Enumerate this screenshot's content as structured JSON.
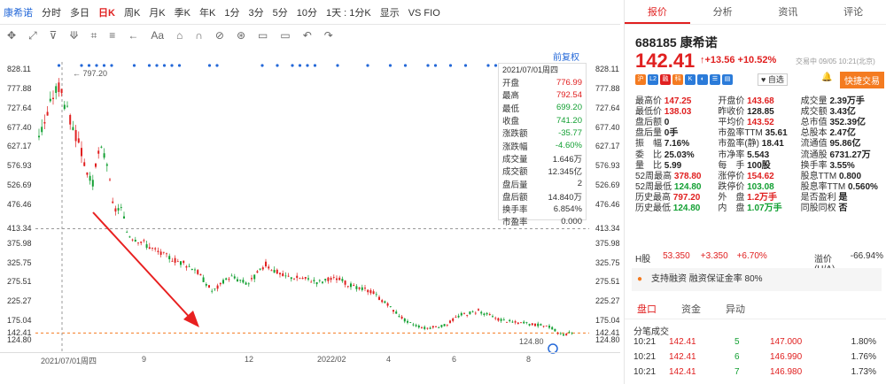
{
  "topbar": {
    "name": "康希诺",
    "items": [
      "分时",
      "多日",
      "日K",
      "周K",
      "月K",
      "季K",
      "年K",
      "1分",
      "3分",
      "5分",
      "10分",
      "1天 : 1分K",
      "显示"
    ],
    "active": "日K",
    "vs": "VS FIO"
  },
  "tools": [
    "✥",
    "⤢",
    "⊽",
    "⟱",
    "⌗",
    "≡",
    "←",
    "Aa",
    "⌂",
    "∩",
    "⊘",
    "⊛",
    "▭",
    "▭",
    "↶",
    "↷"
  ],
  "qfq": "前复权",
  "yaxis": [
    "828.11",
    "777.88",
    "727.64",
    "677.40",
    "627.17",
    "576.93",
    "526.69",
    "476.46",
    "413.34",
    "375.98",
    "325.75",
    "275.51",
    "225.27",
    "175.04",
    "142.41",
    "124.80"
  ],
  "xaxis": [
    "2021/07/01周四",
    "9",
    "12",
    "2022/02",
    "4",
    "6",
    "8"
  ],
  "labels": {
    "high": "797.20",
    "low": "124.80"
  },
  "ohlc": {
    "date": "2021/07/01周四",
    "rows": [
      [
        "开盘",
        "776.99",
        "red"
      ],
      [
        "最高",
        "792.54",
        "red"
      ],
      [
        "最低",
        "699.20",
        "green"
      ],
      [
        "收盘",
        "741.20",
        "green"
      ],
      [
        "涨跌额",
        "-35.77",
        "green"
      ],
      [
        "涨跌幅",
        "-4.60%",
        "green"
      ],
      [
        "成交量",
        "1.646万",
        ""
      ],
      [
        "成交额",
        "12.345亿",
        ""
      ],
      [
        "盘后量",
        "2",
        ""
      ],
      [
        "盘后额",
        "14.840万",
        ""
      ],
      [
        "换手率",
        "6.854%",
        ""
      ],
      [
        "市盈率",
        "0.000",
        ""
      ]
    ]
  },
  "right": {
    "tabs": [
      "报价",
      "分析",
      "资讯",
      "评论"
    ],
    "code": "688185",
    "name": "康希诺",
    "price": "142.41",
    "arrow": "↑",
    "chg": "+13.56",
    "pct": "+10.52%",
    "time": "交易中 09/05 10:21(北京)",
    "zx": "自选",
    "trade": "快捷交易",
    "rows": [
      [
        [
          "最高价",
          "147.25",
          "red"
        ],
        [
          "开盘价",
          "143.68",
          "red"
        ],
        [
          "成交量",
          "2.39万手",
          "blk"
        ]
      ],
      [
        [
          "最低价",
          "138.03",
          "red"
        ],
        [
          "昨收价",
          "128.85",
          "blk"
        ],
        [
          "成交额",
          "3.43亿",
          "blk"
        ]
      ],
      [
        [
          "盘后额",
          "0",
          "blk"
        ],
        [
          "平均价",
          "143.52",
          "red"
        ],
        [
          "总市值",
          "352.39亿",
          "blk"
        ]
      ],
      [
        [
          "盘后量",
          "0手",
          "blk"
        ],
        [
          "市盈率TTM",
          "35.61",
          "blk"
        ],
        [
          "总股本",
          "2.47亿",
          "blk"
        ]
      ],
      [
        [
          "振　幅",
          "7.16%",
          "blk"
        ],
        [
          "市盈率(静)",
          "18.41",
          "blk"
        ],
        [
          "流通值",
          "95.86亿",
          "blk"
        ]
      ],
      [
        [
          "委　比",
          "25.03%",
          "blk"
        ],
        [
          "市净率",
          "5.543",
          "blk"
        ],
        [
          "流通股",
          "6731.27万",
          "blk"
        ]
      ],
      [
        [
          "量　比",
          "5.99",
          "blk"
        ],
        [
          "每　手",
          "100股",
          "blk"
        ],
        [
          "换手率",
          "3.55%",
          "blk"
        ]
      ],
      [
        [
          "52周最高",
          "378.80",
          "red"
        ],
        [
          "涨停价",
          "154.62",
          "red"
        ],
        [
          "股息TTM",
          "0.800",
          "blk"
        ]
      ],
      [
        [
          "52周最低",
          "124.80",
          "green"
        ],
        [
          "跌停价",
          "103.08",
          "green"
        ],
        [
          "股息率TTM",
          "0.560%",
          "blk"
        ]
      ],
      [
        [
          "历史最高",
          "797.20",
          "red"
        ],
        [
          "外　盘",
          "1.2万手",
          "red"
        ],
        [
          "是否盈利",
          "是",
          "blk"
        ]
      ],
      [
        [
          "历史最低",
          "124.80",
          "green"
        ],
        [
          "内　盘",
          "1.07万手",
          "green"
        ],
        [
          "同股同权",
          "否",
          "blk"
        ]
      ]
    ],
    "hk": {
      "label": "H股",
      "price": "53.350",
      "chg": "+3.350",
      "pct": "+6.70%",
      "yl": "溢价(H/A)",
      "ylv": "-66.94%"
    },
    "support": "支持融资 融资保证金率 80%",
    "tabs2": [
      "盘口",
      "资金",
      "异动"
    ],
    "fb": "分笔成交",
    "trades": [
      [
        "10:21",
        "142.41",
        "5",
        "147.000",
        "1.80%"
      ],
      [
        "10:21",
        "142.41",
        "6",
        "146.990",
        "1.76%"
      ],
      [
        "10:21",
        "142.41",
        "7",
        "146.980",
        "1.73%"
      ]
    ]
  }
}
